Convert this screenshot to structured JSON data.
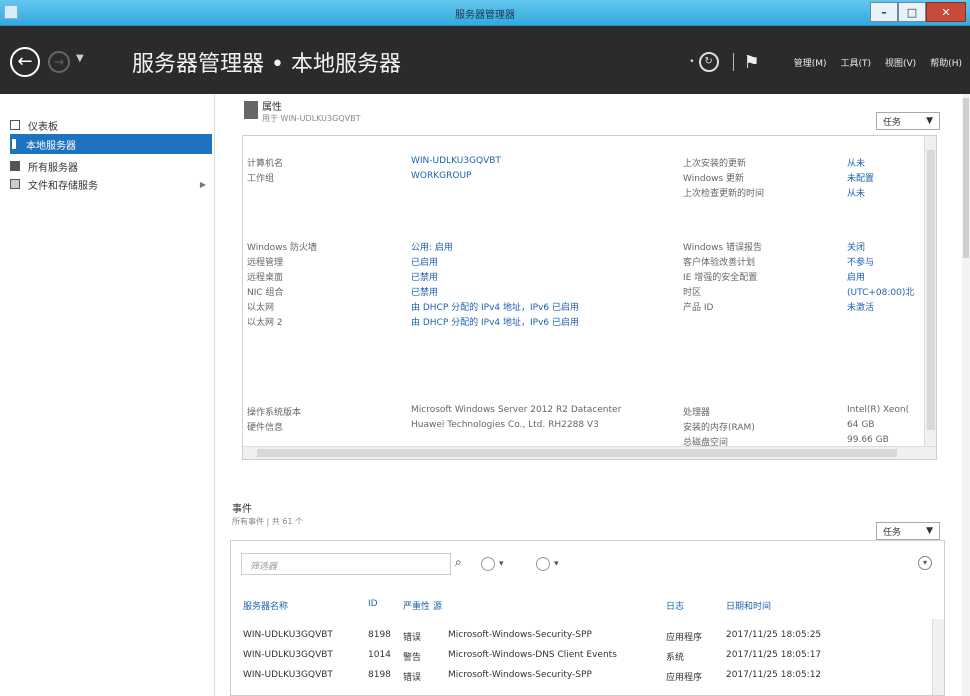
{
  "window": {
    "title": "服务器管理器"
  },
  "header": {
    "breadcrumb": "服务器管理器 • 本地服务器",
    "menus": [
      "管理(M)",
      "工具(T)",
      "视图(V)",
      "帮助(H)"
    ]
  },
  "sidebar": {
    "items": [
      {
        "label": "仪表板"
      },
      {
        "label": "本地服务器"
      },
      {
        "label": "所有服务器"
      },
      {
        "label": "文件和存储服务"
      }
    ]
  },
  "properties": {
    "title": "属性",
    "subtitle": "用于 WIN-UDLKU3GQVBT",
    "tasks_label": "任务",
    "left_block1": [
      {
        "label": "计算机名",
        "value": "WIN-UDLKU3GQVBT"
      },
      {
        "label": "工作组",
        "value": "WORKGROUP"
      }
    ],
    "right_block1": [
      {
        "label": "上次安装的更新",
        "value": "从未"
      },
      {
        "label": "Windows 更新",
        "value": "未配置"
      },
      {
        "label": "上次检查更新的时间",
        "value": "从未"
      }
    ],
    "left_block2": [
      {
        "label": "Windows 防火墙",
        "value": "公用: 启用"
      },
      {
        "label": "远程管理",
        "value": "已启用"
      },
      {
        "label": "远程桌面",
        "value": "已禁用"
      },
      {
        "label": "NIC 组合",
        "value": "已禁用"
      },
      {
        "label": "以太网",
        "value": "由 DHCP 分配的 IPv4 地址，IPv6 已启用"
      },
      {
        "label": "以太网 2",
        "value": "由 DHCP 分配的 IPv4 地址，IPv6 已启用"
      }
    ],
    "right_block2": [
      {
        "label": "Windows 错误报告",
        "value": "关闭"
      },
      {
        "label": "客户体验改善计划",
        "value": "不参与"
      },
      {
        "label": "IE 增强的安全配置",
        "value": "启用"
      },
      {
        "label": "时区",
        "value": "(UTC+08:00)北"
      },
      {
        "label": "产品 ID",
        "value": "未激活"
      }
    ],
    "left_block3": [
      {
        "label": "操作系统版本",
        "value": "Microsoft Windows Server 2012 R2 Datacenter"
      },
      {
        "label": "硬件信息",
        "value": "Huawei Technologies Co., Ltd. RH2288 V3"
      }
    ],
    "right_block3": [
      {
        "label": "处理器",
        "value": "Intel(R) Xeon("
      },
      {
        "label": "安装的内存(RAM)",
        "value": "64 GB"
      },
      {
        "label": "总磁盘空间",
        "value": "99.66 GB"
      }
    ]
  },
  "events": {
    "title": "事件",
    "subtitle": "所有事件 | 共 61 个",
    "tasks_label": "任务",
    "filter_placeholder": "筛选器",
    "columns": [
      "服务器名称",
      "ID",
      "严重性",
      "源",
      "日志",
      "日期和时间"
    ],
    "rows": [
      {
        "server": "WIN-UDLKU3GQVBT",
        "id": "8198",
        "severity": "错误",
        "source": "Microsoft-Windows-Security-SPP",
        "log": "应用程序",
        "datetime": "2017/11/25 18:05:25"
      },
      {
        "server": "WIN-UDLKU3GQVBT",
        "id": "1014",
        "severity": "警告",
        "source": "Microsoft-Windows-DNS Client Events",
        "log": "系统",
        "datetime": "2017/11/25 18:05:17"
      },
      {
        "server": "WIN-UDLKU3GQVBT",
        "id": "8198",
        "severity": "错误",
        "source": "Microsoft-Windows-Security-SPP",
        "log": "应用程序",
        "datetime": "2017/11/25 18:05:12"
      }
    ]
  },
  "colors": {
    "accent": "#1e73be",
    "link": "#1e62b0",
    "header_bg": "#2b2b2b",
    "titlebar": "#33a9dc"
  }
}
